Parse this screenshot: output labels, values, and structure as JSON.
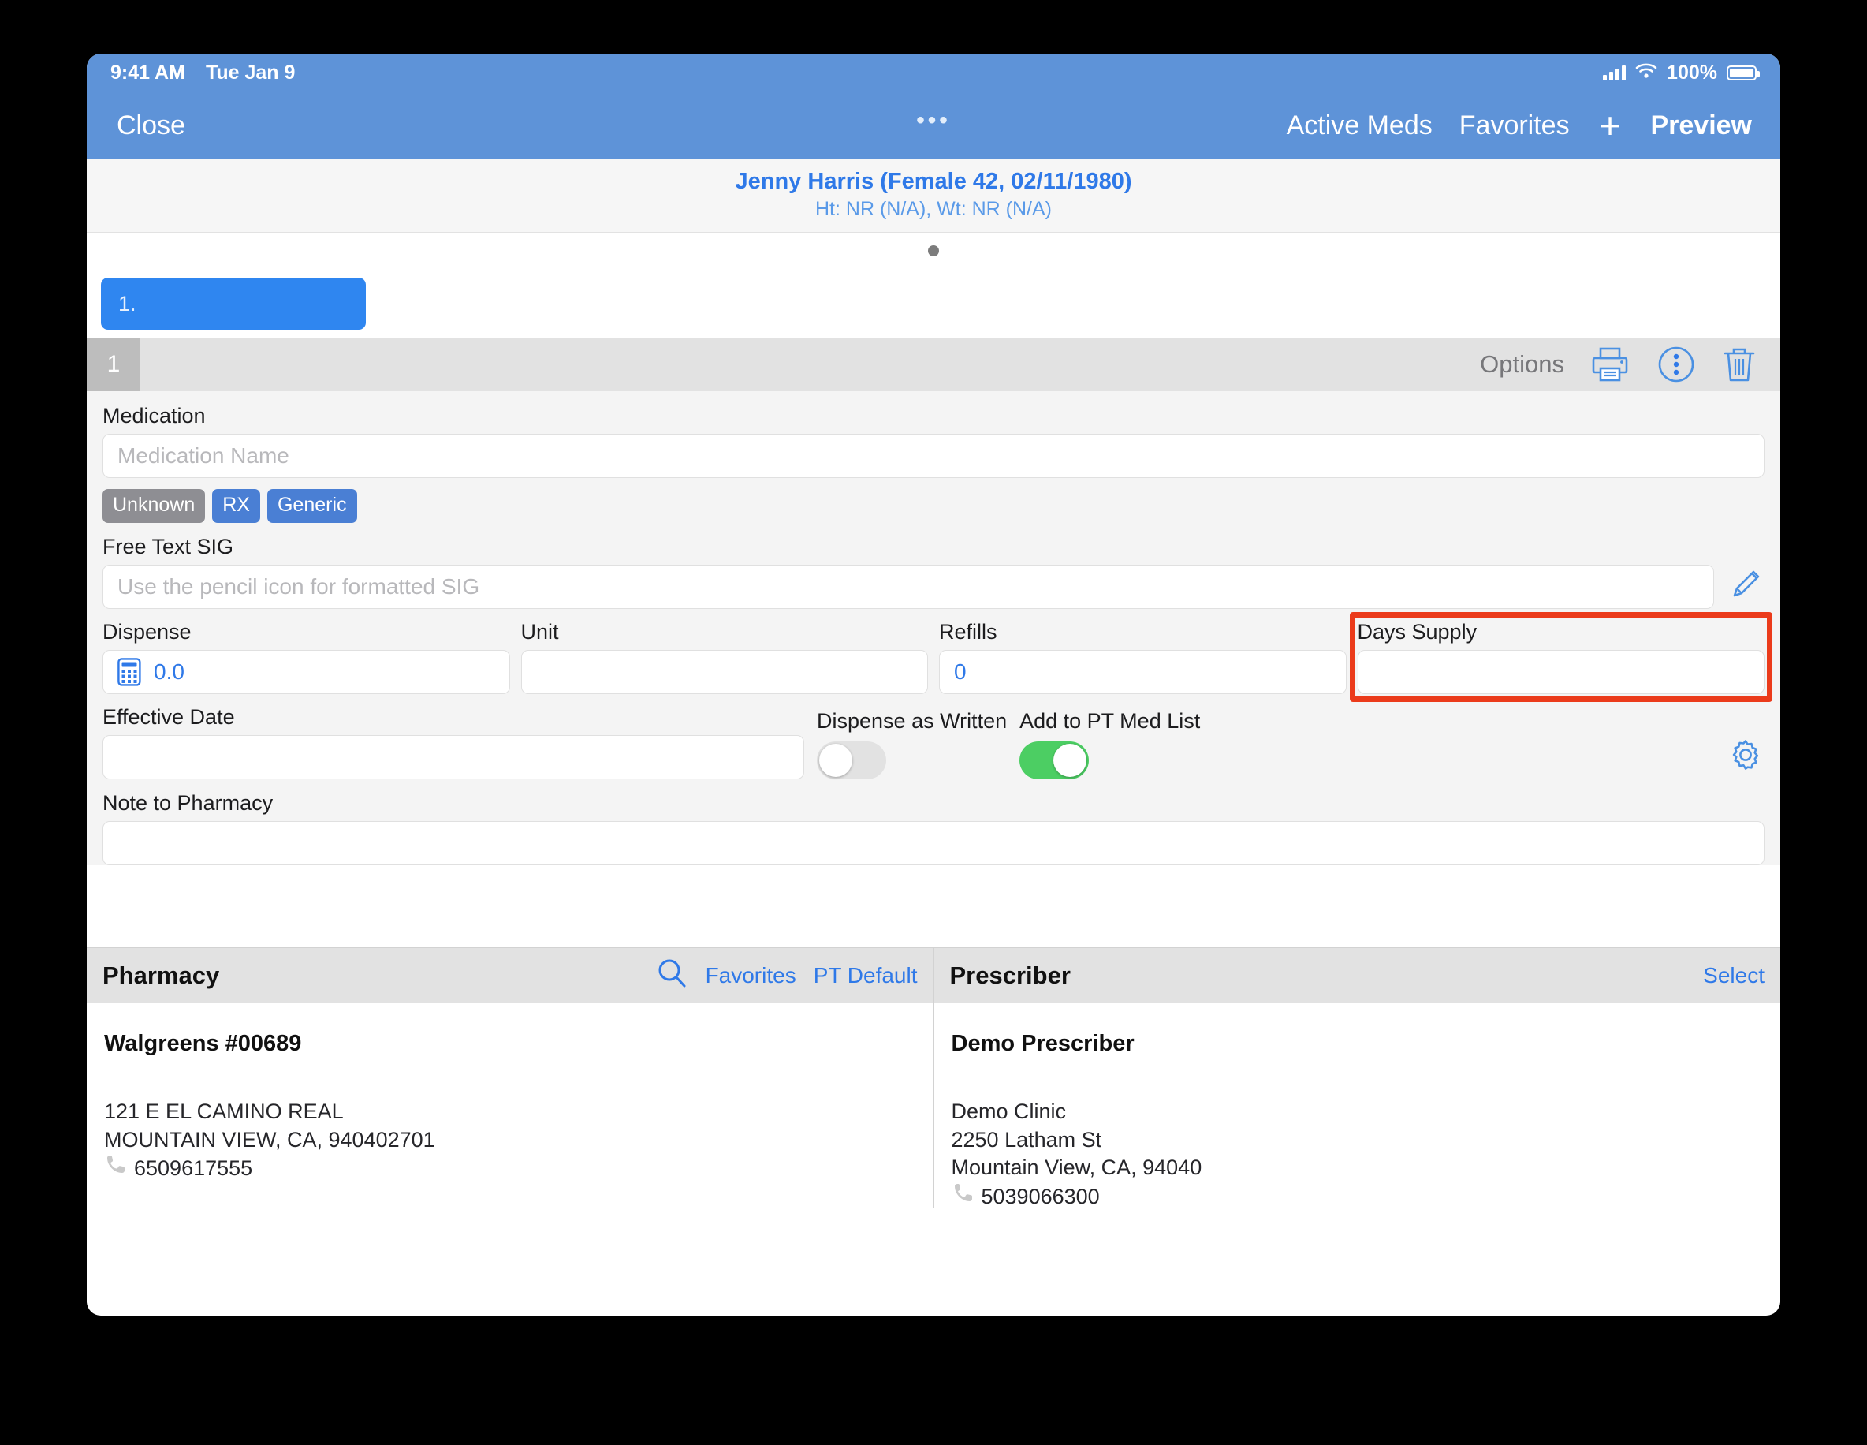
{
  "status_bar": {
    "time": "9:41 AM",
    "date": "Tue Jan 9",
    "battery_percent": "100%",
    "handle_dots": "•••"
  },
  "nav_bar": {
    "close_label": "Close",
    "active_meds_label": "Active Meds",
    "favorites_label": "Favorites",
    "add_label": "+",
    "preview_label": "Preview"
  },
  "patient": {
    "summary": "Jenny Harris (Female 42, 02/11/1980)",
    "vitals": "Ht: NR  (N/A), Wt: NR  (N/A)"
  },
  "carousel": {
    "tab_label": "1."
  },
  "rx_header": {
    "number": "1",
    "options_label": "Options"
  },
  "form": {
    "medication_label": "Medication",
    "medication_placeholder": "Medication Name",
    "badges": [
      {
        "label": "Unknown",
        "style": "gray"
      },
      {
        "label": "RX",
        "style": "blue"
      },
      {
        "label": "Generic",
        "style": "blue"
      }
    ],
    "sig_label": "Free Text SIG",
    "sig_placeholder": "Use the pencil icon for formatted SIG",
    "dispense_label": "Dispense",
    "dispense_value": "0.0",
    "unit_label": "Unit",
    "unit_value": "",
    "refills_label": "Refills",
    "refills_value": "0",
    "days_supply_label": "Days Supply",
    "days_supply_value": "",
    "effective_date_label": "Effective Date",
    "effective_date_value": "",
    "dispense_as_written_label": "Dispense as Written",
    "dispense_as_written_state": "off",
    "add_to_pt_med_list_label": "Add to PT Med List",
    "add_to_pt_med_list_state": "on",
    "note_to_pharmacy_label": "Note to Pharmacy",
    "note_to_pharmacy_value": ""
  },
  "pharmacy": {
    "title": "Pharmacy",
    "favorites_label": "Favorites",
    "pt_default_label": "PT Default",
    "name": "Walgreens #00689",
    "address_line1": "121 E EL CAMINO REAL",
    "address_line2": "MOUNTAIN VIEW, CA, 940402701",
    "phone": "6509617555"
  },
  "prescriber": {
    "title": "Prescriber",
    "select_label": "Select",
    "name": "Demo Prescriber",
    "clinic": "Demo Clinic",
    "address_line1": "2250 Latham St",
    "address_line2": "Mountain View, CA, 94040",
    "phone": "5039066300"
  },
  "colors": {
    "nav_bar": "#5e93d8",
    "accent_blue": "#2f79e8",
    "toggle_on_green": "#4cce63",
    "highlight_red": "#eb3b1b",
    "badge_gray": "#8e8e93",
    "badge_blue": "#4a7fd4"
  }
}
